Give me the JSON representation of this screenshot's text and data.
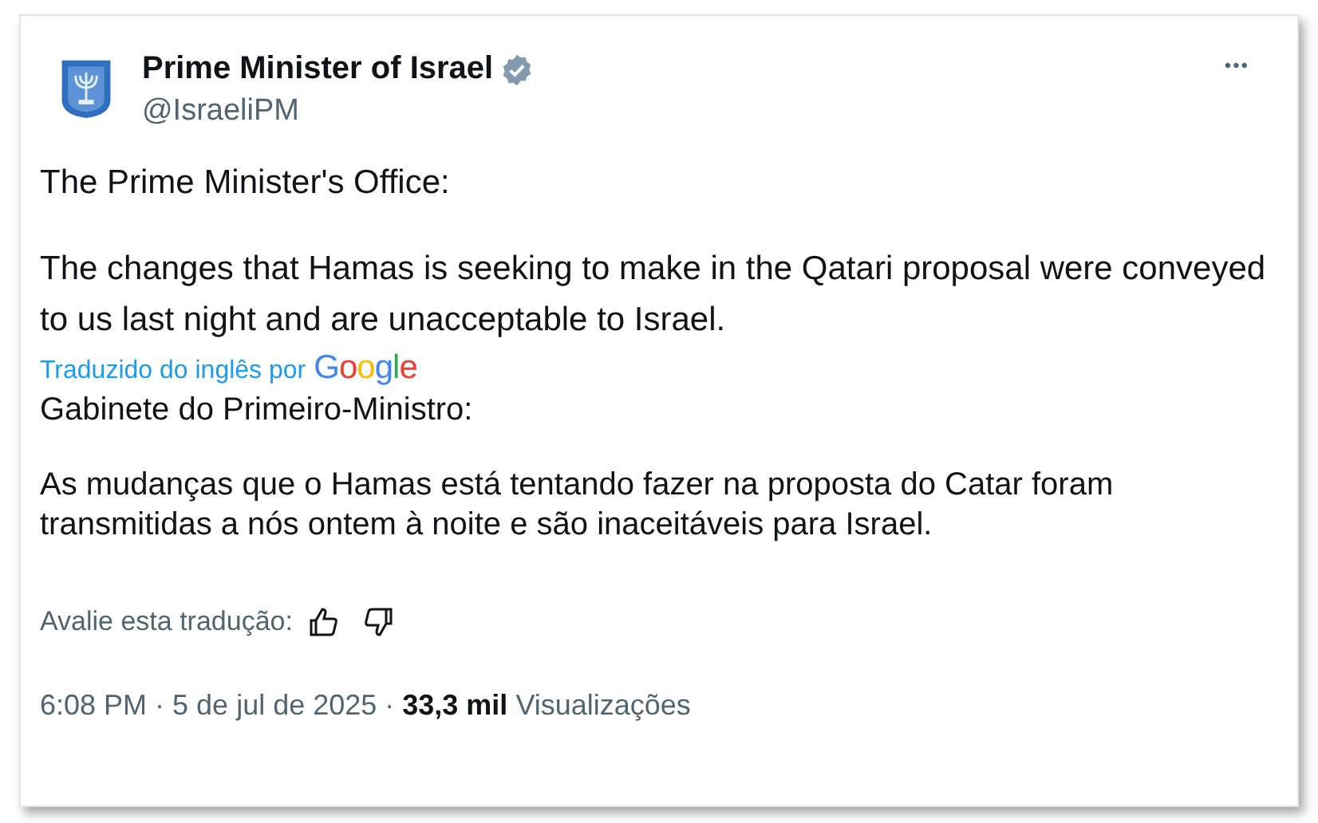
{
  "author": {
    "name": "Prime Minister of Israel",
    "verified": true,
    "handle": "@IsraeliPM"
  },
  "more_menu": "•••",
  "original_text": [
    "The Prime Minister's Office:",
    "The changes that Hamas is seeking to make in the Qatari proposal were conveyed to us last night and are unacceptable to Israel."
  ],
  "translation": {
    "credit": "Traduzido do inglês por",
    "provider": "Google",
    "text": [
      "Gabinete do Primeiro-Ministro:",
      "As mudanças que o Hamas está tentando fazer na proposta do Catar foram transmitidas a nós ontem à noite e são inaceitáveis para Israel."
    ],
    "rate_prompt": "Avalie esta tradução:"
  },
  "meta": "6:08 PM · 5 de jul de 2025 · **33,3 mil** Visualizações"
}
